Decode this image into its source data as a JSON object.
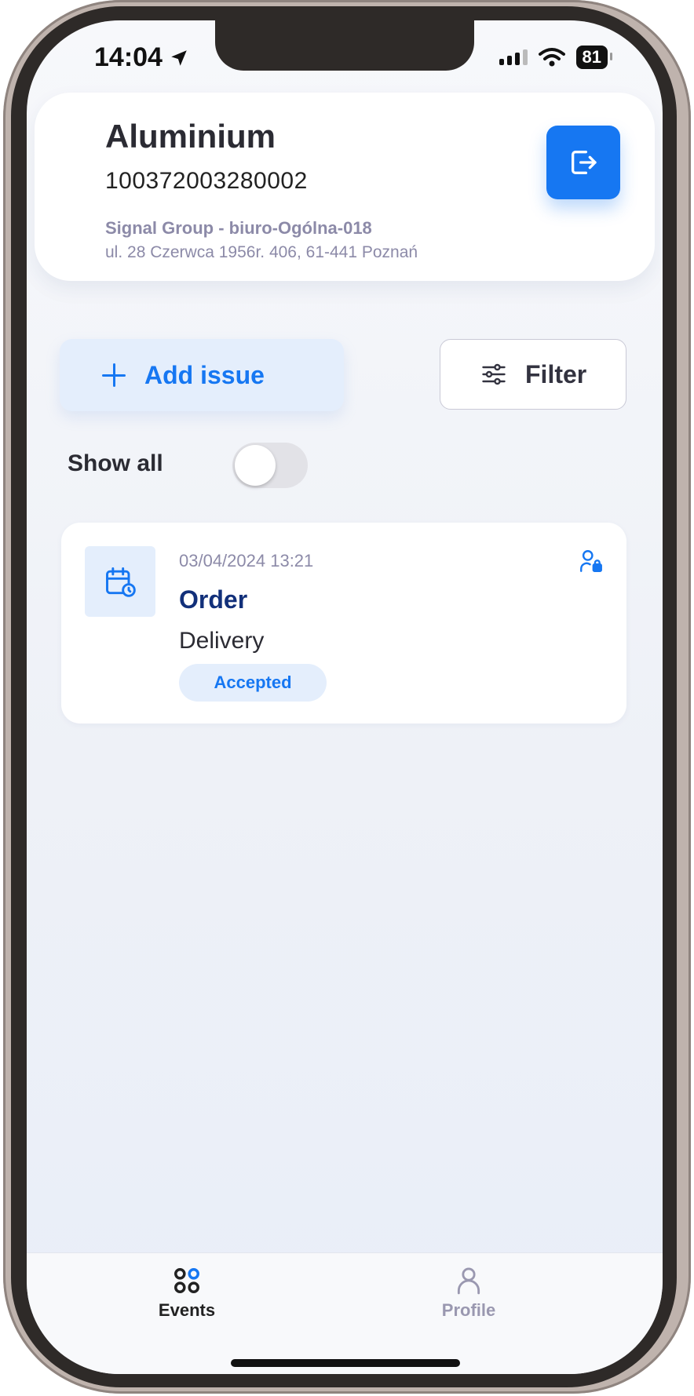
{
  "status_bar": {
    "time": "14:04",
    "battery": "81"
  },
  "header": {
    "title": "Aluminium",
    "code": "100372003280002",
    "company": "Signal Group - biuro-Ogólna-018",
    "address": "ul. 28 Czerwca 1956r. 406, 61-441 Poznań",
    "logout_icon": "logout-icon"
  },
  "actions": {
    "add_issue_label": "Add issue",
    "filter_label": "Filter"
  },
  "show_all": {
    "label": "Show all",
    "enabled": false
  },
  "events": [
    {
      "date": "03/04/2024 13:21",
      "title": "Order",
      "subtitle": "Delivery",
      "status": "Accepted",
      "icon": "calendar-clock-icon"
    }
  ],
  "tabs": [
    {
      "label": "Events",
      "icon": "grid-icon",
      "active": true
    },
    {
      "label": "Profile",
      "icon": "person-icon",
      "active": false
    }
  ],
  "colors": {
    "accent": "#1677f2",
    "accent_light": "#e4eefc",
    "title_dark": "#12307a",
    "muted": "#8c8aa8"
  }
}
